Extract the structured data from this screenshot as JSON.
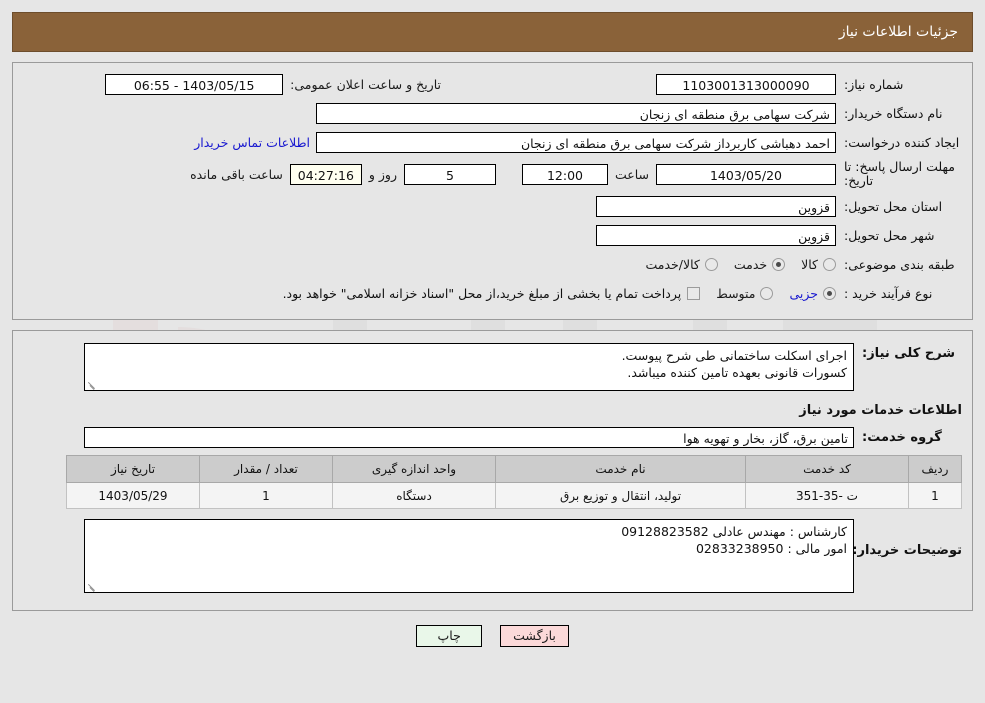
{
  "header": {
    "title": "جزئیات اطلاعات نیاز"
  },
  "watermark": {
    "text": "AriaTender.net"
  },
  "fields": {
    "need_number_label": "شماره نیاز:",
    "need_number_value": "1103001313000090",
    "announce_datetime_label": "تاریخ و ساعت اعلان عمومی:",
    "announce_datetime_value": "1403/05/15 - 06:55",
    "buyer_org_label": "نام دستگاه خریدار:",
    "buyer_org_value": "شرکت سهامی برق منطقه ای زنجان",
    "requester_label": "ایجاد کننده درخواست:",
    "requester_value": "احمد دهباشی کاربرداز شرکت سهامی برق منطقه ای زنجان",
    "contact_link": "اطلاعات تماس خریدار",
    "deadline_label": "مهلت ارسال پاسخ: تا تاریخ:",
    "deadline_date": "1403/05/20",
    "hour_label": "ساعت",
    "hour_value": "12:00",
    "days_value": "5",
    "days_label": "روز و",
    "countdown_value": "04:27:16",
    "remaining_label": "ساعت باقی مانده",
    "province_label": "استان محل تحویل:",
    "province_value": "قزوین",
    "city_label": "شهر محل تحویل:",
    "city_value": "قزوین",
    "category_label": "طبقه بندی موضوعی:",
    "purchase_type_label": "نوع فرآیند خرید :"
  },
  "category_options": [
    {
      "label": "کالا",
      "selected": false
    },
    {
      "label": "خدمت",
      "selected": true
    },
    {
      "label": "کالا/خدمت",
      "selected": false
    }
  ],
  "purchase_options": [
    {
      "label": "جزیی",
      "selected": true
    },
    {
      "label": "متوسط",
      "selected": false
    }
  ],
  "treasury": {
    "checkbox_checked": false,
    "note": "پرداخت تمام یا بخشی از مبلغ خرید،از محل \"اسناد خزانه اسلامی\" خواهد بود."
  },
  "description": {
    "label": "شرح کلی نیاز:",
    "value": "اجرای اسکلت ساختمانی طی شرح پیوست.\nکسورات قانونی بعهده تامین کننده میباشد."
  },
  "services_section": {
    "title": "اطلاعات خدمات مورد نیاز",
    "group_label": "گروه خدمت:",
    "group_value": "تامین برق، گاز، بخار و تهویه هوا"
  },
  "table": {
    "columns": [
      "ردیف",
      "کد خدمت",
      "نام خدمت",
      "واحد اندازه گیری",
      "تعداد / مقدار",
      "تاریخ نیاز"
    ],
    "rows": [
      {
        "row_no": "1",
        "service_code": "ت -35-351",
        "service_name": "تولید، انتقال و توزیع برق",
        "unit": "دستگاه",
        "quantity": "1",
        "need_date": "1403/05/29"
      }
    ]
  },
  "buyer_notes": {
    "label": "توضیحات خریدار:",
    "value": "کارشناس : مهندس عادلی 09128823582\nامور مالی : 02833238950"
  },
  "buttons": {
    "print": "چاپ",
    "back": "بازگشت"
  },
  "colors": {
    "header_bg": "#8a6239",
    "link": "#1818d0",
    "print_btn": "#e9f7e9",
    "back_btn": "#fbd9d9",
    "table_header": "#cccccc"
  }
}
